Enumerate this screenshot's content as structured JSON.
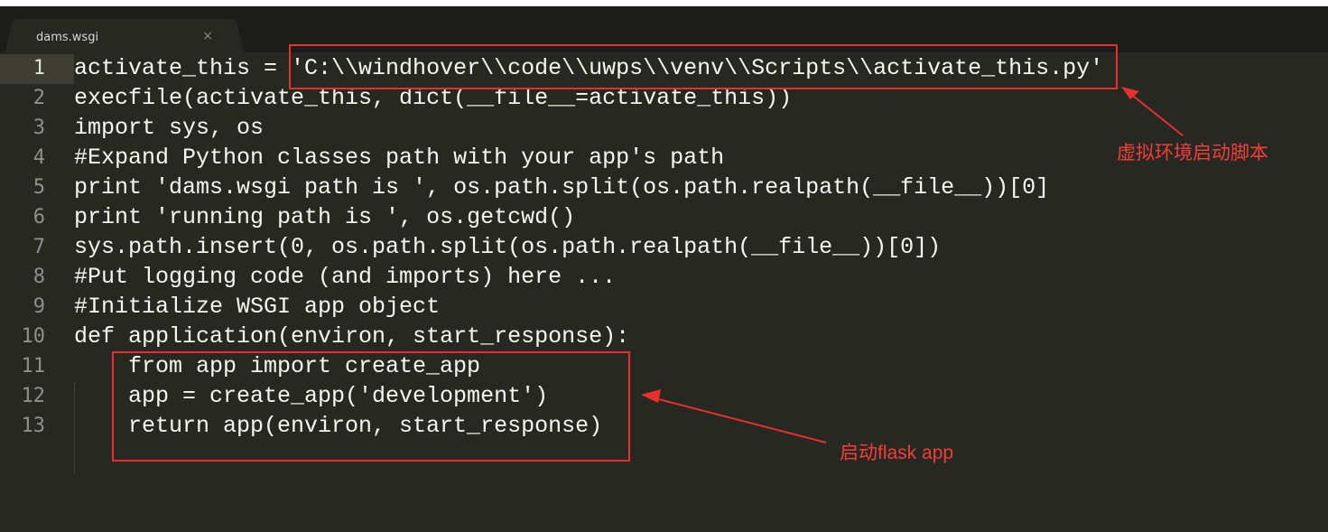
{
  "window": {
    "top_strip_text": "…"
  },
  "tab": {
    "label": "dams.wsgi",
    "close_glyph": "×"
  },
  "editor": {
    "active_line": 1,
    "lines": [
      {
        "num": "1",
        "text": "activate_this = 'C:\\\\windhover\\\\code\\\\uwps\\\\venv\\\\Scripts\\\\activate_this.py'",
        "indent": false
      },
      {
        "num": "2",
        "text": "execfile(activate_this, dict(__file__=activate_this))",
        "indent": false
      },
      {
        "num": "3",
        "text": "import sys, os",
        "indent": false
      },
      {
        "num": "4",
        "text": "#Expand Python classes path with your app's path",
        "indent": false
      },
      {
        "num": "5",
        "text": "print 'dams.wsgi path is ', os.path.split(os.path.realpath(__file__))[0]",
        "indent": false
      },
      {
        "num": "6",
        "text": "print 'running path is ', os.getcwd()",
        "indent": false
      },
      {
        "num": "7",
        "text": "sys.path.insert(0, os.path.split(os.path.realpath(__file__))[0])",
        "indent": false
      },
      {
        "num": "8",
        "text": "#Put logging code (and imports) here ...",
        "indent": false
      },
      {
        "num": "9",
        "text": "#Initialize WSGI app object",
        "indent": false
      },
      {
        "num": "10",
        "text": "def application(environ, start_response):",
        "indent": false
      },
      {
        "num": "11",
        "text": "from app import create_app",
        "indent": true
      },
      {
        "num": "12",
        "text": "app = create_app('development')",
        "indent": true
      },
      {
        "num": "13",
        "text": "return app(environ, start_response)",
        "indent": true
      }
    ]
  },
  "annotations": {
    "venv_note": "虚拟环境启动脚本",
    "flask_note": "启动flask app",
    "highlight_color": "#e8302a",
    "note_color": "#f33e3a"
  },
  "colors": {
    "editor_bg": "#272822",
    "tabbar_bg": "#1c1d18",
    "active_line_bg": "#3e3d32"
  }
}
